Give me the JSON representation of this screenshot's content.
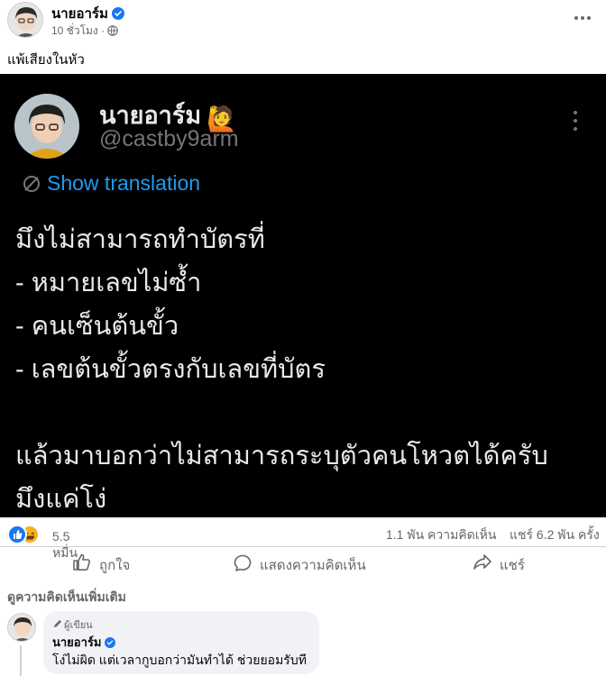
{
  "post": {
    "author": "นายอาร์ม",
    "time": "10 ชั่วโมง",
    "meta_separator": "·",
    "text": "แพ้เสียงในหัว"
  },
  "tweet": {
    "name": "นายอาร์ม",
    "emoji": "🙋",
    "handle": "@castby9arm",
    "translate": "Show translation",
    "lines": [
      "มึงไม่สามารถทำบัตรที่",
      "- หมายเลขไม่ซ้ำ",
      "- คนเซ็นต้นขั้ว",
      "- เลขต้นขั้วตรงกับเลขที่บัตร",
      "",
      "แล้วมาบอกว่าไม่สามารถระบุตัวคนโหวตได้ครับ",
      "มึงแค่โง่"
    ]
  },
  "stats": {
    "reactions": "5.5 หมื่น",
    "comments": "1.1 พัน ความคิดเห็น",
    "shares": "แชร์ 6.2 พัน ครั้ง"
  },
  "actions": {
    "like": "ถูกใจ",
    "comment": "แสดงความคิดเห็น",
    "share": "แชร์"
  },
  "comments": {
    "view_more": "ดูความคิดเห็นเพิ่มเติม",
    "items": [
      {
        "badge": "ผู้เขียน",
        "name": "นายอาร์ม",
        "text": "โง่ไม่ผิด แต่เวลากูบอกว่ามันทำได้ ช่วยยอมรับที"
      }
    ]
  },
  "colors": {
    "facebook_blue": "#1877f2",
    "twitter_blue": "#1d9bf0",
    "tweet_background": "#000000",
    "secondary_text": "#65676b"
  },
  "icons": [
    "verified-badge-icon",
    "globe-icon",
    "more-options-icon",
    "translate-icon",
    "like-reaction-icon",
    "haha-reaction-icon",
    "thumbs-up-icon",
    "comment-bubble-icon",
    "share-arrow-icon",
    "author-pen-icon"
  ]
}
